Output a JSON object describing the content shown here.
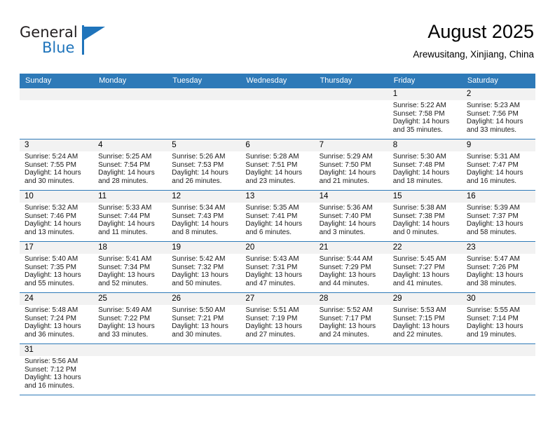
{
  "brand": {
    "name_part1": "General",
    "name_part2": "Blue",
    "flag_icon": "triangle-flag-icon"
  },
  "header": {
    "title": "August 2025",
    "location": "Arewusitang, Xinjiang, China"
  },
  "colors": {
    "header_blue": "#2e7ab8",
    "daynum_band": "#f2f2f2",
    "brand_blue": "#1f74bb"
  },
  "weekdays": [
    "Sunday",
    "Monday",
    "Tuesday",
    "Wednesday",
    "Thursday",
    "Friday",
    "Saturday"
  ],
  "weeks": [
    [
      {
        "day": "",
        "sunrise": "",
        "sunset": "",
        "daylight1": "",
        "daylight2": ""
      },
      {
        "day": "",
        "sunrise": "",
        "sunset": "",
        "daylight1": "",
        "daylight2": ""
      },
      {
        "day": "",
        "sunrise": "",
        "sunset": "",
        "daylight1": "",
        "daylight2": ""
      },
      {
        "day": "",
        "sunrise": "",
        "sunset": "",
        "daylight1": "",
        "daylight2": ""
      },
      {
        "day": "",
        "sunrise": "",
        "sunset": "",
        "daylight1": "",
        "daylight2": ""
      },
      {
        "day": "1",
        "sunrise": "Sunrise: 5:22 AM",
        "sunset": "Sunset: 7:58 PM",
        "daylight1": "Daylight: 14 hours",
        "daylight2": "and 35 minutes."
      },
      {
        "day": "2",
        "sunrise": "Sunrise: 5:23 AM",
        "sunset": "Sunset: 7:56 PM",
        "daylight1": "Daylight: 14 hours",
        "daylight2": "and 33 minutes."
      }
    ],
    [
      {
        "day": "3",
        "sunrise": "Sunrise: 5:24 AM",
        "sunset": "Sunset: 7:55 PM",
        "daylight1": "Daylight: 14 hours",
        "daylight2": "and 30 minutes."
      },
      {
        "day": "4",
        "sunrise": "Sunrise: 5:25 AM",
        "sunset": "Sunset: 7:54 PM",
        "daylight1": "Daylight: 14 hours",
        "daylight2": "and 28 minutes."
      },
      {
        "day": "5",
        "sunrise": "Sunrise: 5:26 AM",
        "sunset": "Sunset: 7:53 PM",
        "daylight1": "Daylight: 14 hours",
        "daylight2": "and 26 minutes."
      },
      {
        "day": "6",
        "sunrise": "Sunrise: 5:28 AM",
        "sunset": "Sunset: 7:51 PM",
        "daylight1": "Daylight: 14 hours",
        "daylight2": "and 23 minutes."
      },
      {
        "day": "7",
        "sunrise": "Sunrise: 5:29 AM",
        "sunset": "Sunset: 7:50 PM",
        "daylight1": "Daylight: 14 hours",
        "daylight2": "and 21 minutes."
      },
      {
        "day": "8",
        "sunrise": "Sunrise: 5:30 AM",
        "sunset": "Sunset: 7:48 PM",
        "daylight1": "Daylight: 14 hours",
        "daylight2": "and 18 minutes."
      },
      {
        "day": "9",
        "sunrise": "Sunrise: 5:31 AM",
        "sunset": "Sunset: 7:47 PM",
        "daylight1": "Daylight: 14 hours",
        "daylight2": "and 16 minutes."
      }
    ],
    [
      {
        "day": "10",
        "sunrise": "Sunrise: 5:32 AM",
        "sunset": "Sunset: 7:46 PM",
        "daylight1": "Daylight: 14 hours",
        "daylight2": "and 13 minutes."
      },
      {
        "day": "11",
        "sunrise": "Sunrise: 5:33 AM",
        "sunset": "Sunset: 7:44 PM",
        "daylight1": "Daylight: 14 hours",
        "daylight2": "and 11 minutes."
      },
      {
        "day": "12",
        "sunrise": "Sunrise: 5:34 AM",
        "sunset": "Sunset: 7:43 PM",
        "daylight1": "Daylight: 14 hours",
        "daylight2": "and 8 minutes."
      },
      {
        "day": "13",
        "sunrise": "Sunrise: 5:35 AM",
        "sunset": "Sunset: 7:41 PM",
        "daylight1": "Daylight: 14 hours",
        "daylight2": "and 6 minutes."
      },
      {
        "day": "14",
        "sunrise": "Sunrise: 5:36 AM",
        "sunset": "Sunset: 7:40 PM",
        "daylight1": "Daylight: 14 hours",
        "daylight2": "and 3 minutes."
      },
      {
        "day": "15",
        "sunrise": "Sunrise: 5:38 AM",
        "sunset": "Sunset: 7:38 PM",
        "daylight1": "Daylight: 14 hours",
        "daylight2": "and 0 minutes."
      },
      {
        "day": "16",
        "sunrise": "Sunrise: 5:39 AM",
        "sunset": "Sunset: 7:37 PM",
        "daylight1": "Daylight: 13 hours",
        "daylight2": "and 58 minutes."
      }
    ],
    [
      {
        "day": "17",
        "sunrise": "Sunrise: 5:40 AM",
        "sunset": "Sunset: 7:35 PM",
        "daylight1": "Daylight: 13 hours",
        "daylight2": "and 55 minutes."
      },
      {
        "day": "18",
        "sunrise": "Sunrise: 5:41 AM",
        "sunset": "Sunset: 7:34 PM",
        "daylight1": "Daylight: 13 hours",
        "daylight2": "and 52 minutes."
      },
      {
        "day": "19",
        "sunrise": "Sunrise: 5:42 AM",
        "sunset": "Sunset: 7:32 PM",
        "daylight1": "Daylight: 13 hours",
        "daylight2": "and 50 minutes."
      },
      {
        "day": "20",
        "sunrise": "Sunrise: 5:43 AM",
        "sunset": "Sunset: 7:31 PM",
        "daylight1": "Daylight: 13 hours",
        "daylight2": "and 47 minutes."
      },
      {
        "day": "21",
        "sunrise": "Sunrise: 5:44 AM",
        "sunset": "Sunset: 7:29 PM",
        "daylight1": "Daylight: 13 hours",
        "daylight2": "and 44 minutes."
      },
      {
        "day": "22",
        "sunrise": "Sunrise: 5:45 AM",
        "sunset": "Sunset: 7:27 PM",
        "daylight1": "Daylight: 13 hours",
        "daylight2": "and 41 minutes."
      },
      {
        "day": "23",
        "sunrise": "Sunrise: 5:47 AM",
        "sunset": "Sunset: 7:26 PM",
        "daylight1": "Daylight: 13 hours",
        "daylight2": "and 38 minutes."
      }
    ],
    [
      {
        "day": "24",
        "sunrise": "Sunrise: 5:48 AM",
        "sunset": "Sunset: 7:24 PM",
        "daylight1": "Daylight: 13 hours",
        "daylight2": "and 36 minutes."
      },
      {
        "day": "25",
        "sunrise": "Sunrise: 5:49 AM",
        "sunset": "Sunset: 7:22 PM",
        "daylight1": "Daylight: 13 hours",
        "daylight2": "and 33 minutes."
      },
      {
        "day": "26",
        "sunrise": "Sunrise: 5:50 AM",
        "sunset": "Sunset: 7:21 PM",
        "daylight1": "Daylight: 13 hours",
        "daylight2": "and 30 minutes."
      },
      {
        "day": "27",
        "sunrise": "Sunrise: 5:51 AM",
        "sunset": "Sunset: 7:19 PM",
        "daylight1": "Daylight: 13 hours",
        "daylight2": "and 27 minutes."
      },
      {
        "day": "28",
        "sunrise": "Sunrise: 5:52 AM",
        "sunset": "Sunset: 7:17 PM",
        "daylight1": "Daylight: 13 hours",
        "daylight2": "and 24 minutes."
      },
      {
        "day": "29",
        "sunrise": "Sunrise: 5:53 AM",
        "sunset": "Sunset: 7:15 PM",
        "daylight1": "Daylight: 13 hours",
        "daylight2": "and 22 minutes."
      },
      {
        "day": "30",
        "sunrise": "Sunrise: 5:55 AM",
        "sunset": "Sunset: 7:14 PM",
        "daylight1": "Daylight: 13 hours",
        "daylight2": "and 19 minutes."
      }
    ],
    [
      {
        "day": "31",
        "sunrise": "Sunrise: 5:56 AM",
        "sunset": "Sunset: 7:12 PM",
        "daylight1": "Daylight: 13 hours",
        "daylight2": "and 16 minutes."
      },
      {
        "day": "",
        "sunrise": "",
        "sunset": "",
        "daylight1": "",
        "daylight2": ""
      },
      {
        "day": "",
        "sunrise": "",
        "sunset": "",
        "daylight1": "",
        "daylight2": ""
      },
      {
        "day": "",
        "sunrise": "",
        "sunset": "",
        "daylight1": "",
        "daylight2": ""
      },
      {
        "day": "",
        "sunrise": "",
        "sunset": "",
        "daylight1": "",
        "daylight2": ""
      },
      {
        "day": "",
        "sunrise": "",
        "sunset": "",
        "daylight1": "",
        "daylight2": ""
      },
      {
        "day": "",
        "sunrise": "",
        "sunset": "",
        "daylight1": "",
        "daylight2": ""
      }
    ]
  ]
}
